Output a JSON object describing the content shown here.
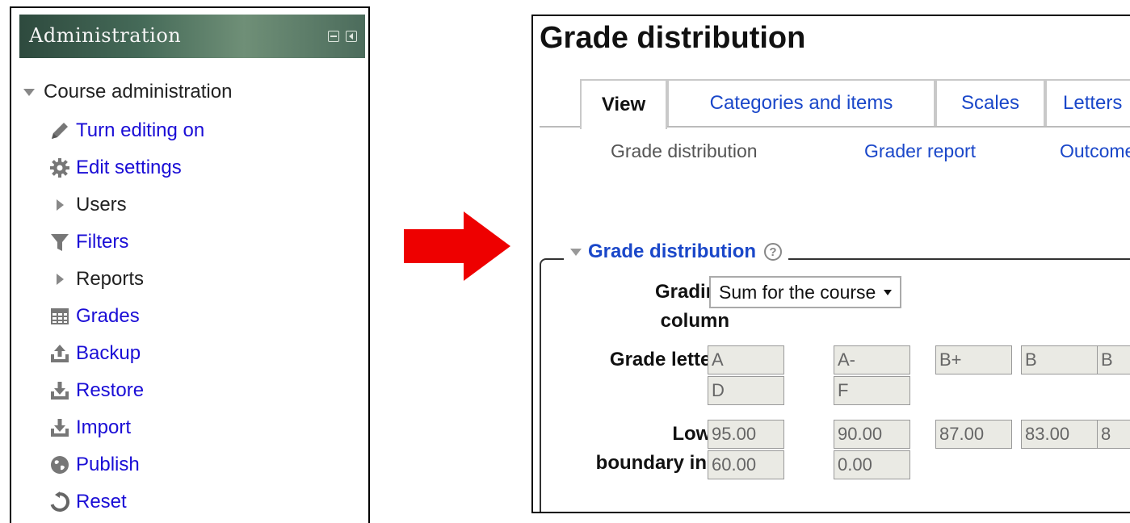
{
  "admin": {
    "title": "Administration",
    "course_admin_label": "Course administration",
    "items": [
      {
        "label": "Turn editing on",
        "icon": "pencil-icon",
        "link": true
      },
      {
        "label": "Edit settings",
        "icon": "gear-icon",
        "link": true
      },
      {
        "label": "Users",
        "icon": "triangle-right-icon",
        "link": false
      },
      {
        "label": "Filters",
        "icon": "filter-icon",
        "link": true
      },
      {
        "label": "Reports",
        "icon": "triangle-right-icon",
        "link": false
      },
      {
        "label": "Grades",
        "icon": "table-icon",
        "link": true
      },
      {
        "label": "Backup",
        "icon": "upload-icon",
        "link": true
      },
      {
        "label": "Restore",
        "icon": "download-icon",
        "link": true
      },
      {
        "label": "Import",
        "icon": "download-icon",
        "link": true
      },
      {
        "label": "Publish",
        "icon": "globe-icon",
        "link": true
      },
      {
        "label": "Reset",
        "icon": "reset-icon",
        "link": true
      }
    ]
  },
  "grade": {
    "title": "Grade distribution",
    "tabs": [
      "View",
      "Categories and items",
      "Scales",
      "Letters"
    ],
    "subtabs": [
      "Grade distribution",
      "Grader report",
      "Outcomes"
    ],
    "section_label": "Grade distribution",
    "help_glyph": "?",
    "grading_column_label_1": "Grading",
    "grading_column_label_2": "column",
    "grading_column_value": "Sum for the course",
    "grade_letters_label": "Grade letters",
    "letters_row1": [
      "A",
      "A-",
      "B+",
      "B",
      "B"
    ],
    "letters_row2": [
      "D",
      "F"
    ],
    "lower_boundary_label_1": "Lower",
    "lower_boundary_label_2": "boundary in %",
    "boundary_row1": [
      "95.00",
      "90.00",
      "87.00",
      "83.00",
      "8"
    ],
    "boundary_row2": [
      "60.00",
      "0.00"
    ]
  },
  "colors": {
    "link": "#1a0dd6",
    "tab_link": "#1a47c9",
    "arrow": "#ee0000",
    "input_bg": "#eaeae4"
  }
}
